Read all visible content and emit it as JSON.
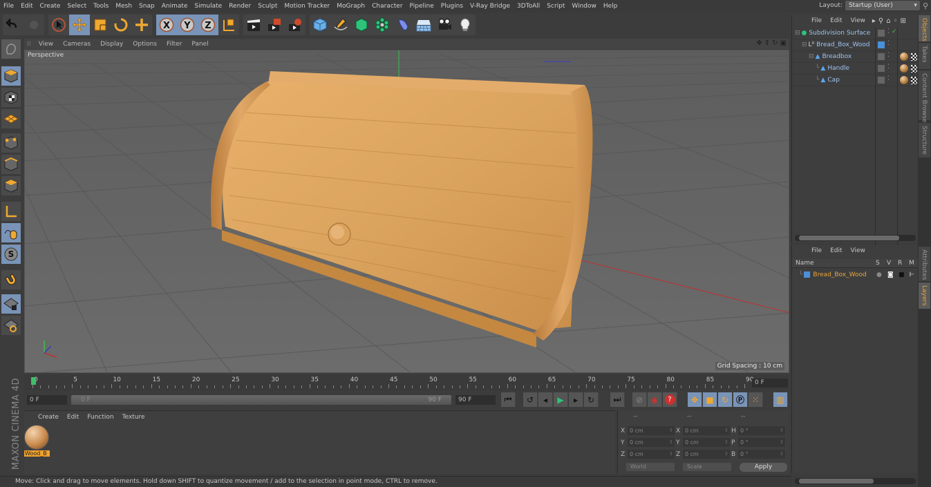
{
  "menubar": {
    "items": [
      "File",
      "Edit",
      "Create",
      "Select",
      "Tools",
      "Mesh",
      "Snap",
      "Animate",
      "Simulate",
      "Render",
      "Sculpt",
      "Motion Tracker",
      "MoGraph",
      "Character",
      "Pipeline",
      "Plugins",
      "V-Ray Bridge",
      "3DToAll",
      "Script",
      "Window",
      "Help"
    ],
    "layout_label": "Layout:",
    "layout_value": "Startup (User)"
  },
  "toolbar": {
    "groups": [
      [
        "undo-icon",
        "redo-icon"
      ],
      [
        "live-selection-icon",
        "move-icon",
        "scale-icon",
        "rotate-icon",
        "add-object-icon"
      ],
      [
        "x-axis-icon",
        "y-axis-icon",
        "z-axis-icon",
        "coordinate-system-icon"
      ],
      [
        "render-view-icon",
        "render-picture-viewer-icon",
        "render-settings-icon"
      ],
      [
        "cube-icon",
        "pen-spline-icon",
        "subdivision-icon",
        "array-icon",
        "deformer-icon",
        "floor-icon",
        "camera-icon",
        "light-icon"
      ]
    ]
  },
  "sidetools": [
    "make-editable-icon",
    "model-mode-icon",
    "texture-mode-icon",
    "workplane-mode-icon",
    "points-mode-icon",
    "edges-mode-icon",
    "polygons-mode-icon",
    "axis-mode-icon",
    "tweak-mode-icon",
    "solo-mode-icon",
    "snapping-icon",
    "workplane-lock-icon",
    "workplane-align-icon"
  ],
  "viewport": {
    "menu": [
      "View",
      "Cameras",
      "Display",
      "Options",
      "Filter",
      "Panel"
    ],
    "label": "Perspective",
    "grid_spacing": "Grid Spacing : 10 cm"
  },
  "timeline": {
    "ticks": [
      0,
      5,
      10,
      15,
      20,
      25,
      30,
      35,
      40,
      45,
      50,
      55,
      60,
      65,
      70,
      75,
      80,
      85,
      90
    ],
    "current_frame_field": "0 F"
  },
  "transport": {
    "start_field": "0 F",
    "range_start": "0 F",
    "range_end": "90 F",
    "end_field": "90 F"
  },
  "materials": {
    "menu": [
      "Create",
      "Edit",
      "Function",
      "Texture"
    ],
    "items": [
      {
        "name": "Wood_B"
      }
    ]
  },
  "coordinates": {
    "headers": [
      "--",
      "--",
      "--"
    ],
    "rows": [
      {
        "l1": "X",
        "v1": "0 cm",
        "l2": "X",
        "v2": "0 cm",
        "l3": "H",
        "v3": "0 °"
      },
      {
        "l1": "Y",
        "v1": "0 cm",
        "l2": "Y",
        "v2": "0 cm",
        "l3": "P",
        "v3": "0 °"
      },
      {
        "l1": "Z",
        "v1": "0 cm",
        "l2": "Z",
        "v2": "0 cm",
        "l3": "B",
        "v3": "0 °"
      }
    ],
    "mode": "World",
    "transform": "Scale",
    "apply": "Apply"
  },
  "status": "Move: Click and drag to move elements. Hold down SHIFT to quantize movement / add to the selection in point mode, CTRL to remove.",
  "brand": "MAXON CINEMA 4D",
  "objects": {
    "menu": [
      "File",
      "Edit",
      "View"
    ],
    "items": [
      {
        "name": "Subdivision Surface",
        "depth": 0,
        "icon": "subdivision-surface-icon"
      },
      {
        "name": "Bread_Box_Wood",
        "depth": 1,
        "icon": "null-object-icon"
      },
      {
        "name": "Breadbox",
        "depth": 2,
        "icon": "polygon-object-icon"
      },
      {
        "name": "Handle",
        "depth": 3,
        "icon": "polygon-object-icon"
      },
      {
        "name": "Cap",
        "depth": 3,
        "icon": "polygon-object-icon"
      }
    ]
  },
  "layers": {
    "menu": [
      "File",
      "Edit",
      "View"
    ],
    "columns": [
      "Name",
      "S",
      "V",
      "R",
      "M"
    ],
    "items": [
      {
        "name": "Bread_Box_Wood",
        "color": "#4a90d9"
      }
    ]
  },
  "right_tabs": {
    "top": [
      "Objects",
      "Takes",
      "Content Browser",
      "Structure"
    ],
    "bottom": [
      "Attributes",
      "Layers"
    ]
  },
  "colors": {
    "accent": "#e8a640",
    "selected_tool": "#7a94b8",
    "object_name": "#9ec3ef",
    "layer_name": "#e8a640"
  }
}
